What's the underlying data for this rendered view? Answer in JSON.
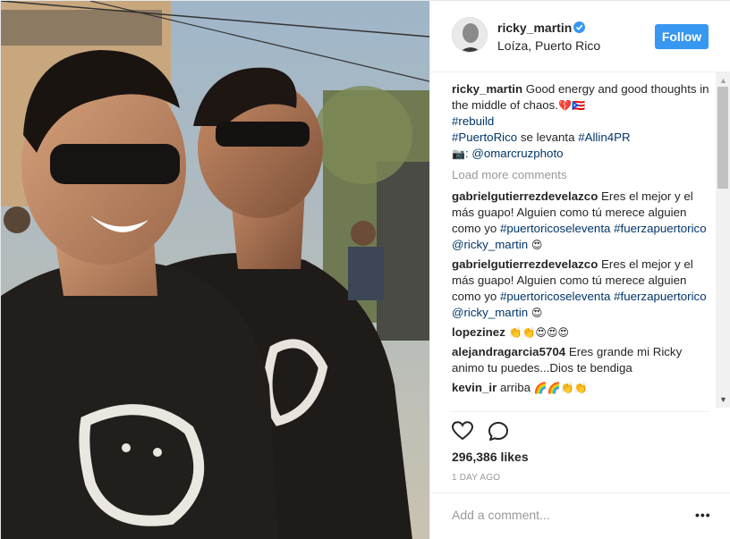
{
  "photo": {
    "description_icon": "photo-two-men-black-tshirts"
  },
  "header": {
    "username": "ricky_martin",
    "location": "Loíza, Puerto Rico",
    "follow_label": "Follow",
    "verified_icon": "verified-badge-icon"
  },
  "caption": {
    "username": "ricky_martin",
    "text": "Good energy and good thoughts in the middle of chaos.",
    "emoji": "💔🇵🇷",
    "tag_rebuild": "#rebuild",
    "tag_puertorico": "#PuertoRico",
    "mid_text": "se levanta",
    "tag_allin": "#Allin4PR",
    "camera_emoji": "📷",
    "credit": ": @omarcruzphoto"
  },
  "load_more": "Load more comments",
  "comments": [
    {
      "username": "gabrielgutierrezdevelazco",
      "text": "Eres el mejor y el más guapo! Alguien como tú merece alguien como yo",
      "tag1": "#puertoricoseleventa",
      "tag2": "#fuerzapuertorico",
      "mention": "@ricky_martin",
      "emoji": "😍"
    },
    {
      "username": "gabrielgutierrezdevelazco",
      "text": "Eres el mejor y el más guapo! Alguien como tú merece alguien como yo",
      "tag1": "#puertoricoseleventa",
      "tag2": "#fuerzapuertorico",
      "mention": "@ricky_martin",
      "emoji": "😍"
    },
    {
      "username": "lopezinez",
      "text": "",
      "emoji": "👏👏😍😍😍"
    },
    {
      "username": "alejandragarcia5704",
      "text": "Eres grande mi Ricky animo tu puedes...Dios te bendiga",
      "emoji": ""
    },
    {
      "username": "kevin_ir",
      "text": "arriba",
      "emoji": "🌈🌈👏👏"
    }
  ],
  "likes": "296,386 likes",
  "timestamp": "1 DAY AGO",
  "add_comment_placeholder": "Add a comment...",
  "more_options": "•••",
  "colors": {
    "accent": "#3897f0",
    "hashtag": "#003569",
    "muted": "#999999",
    "text": "#262626"
  }
}
